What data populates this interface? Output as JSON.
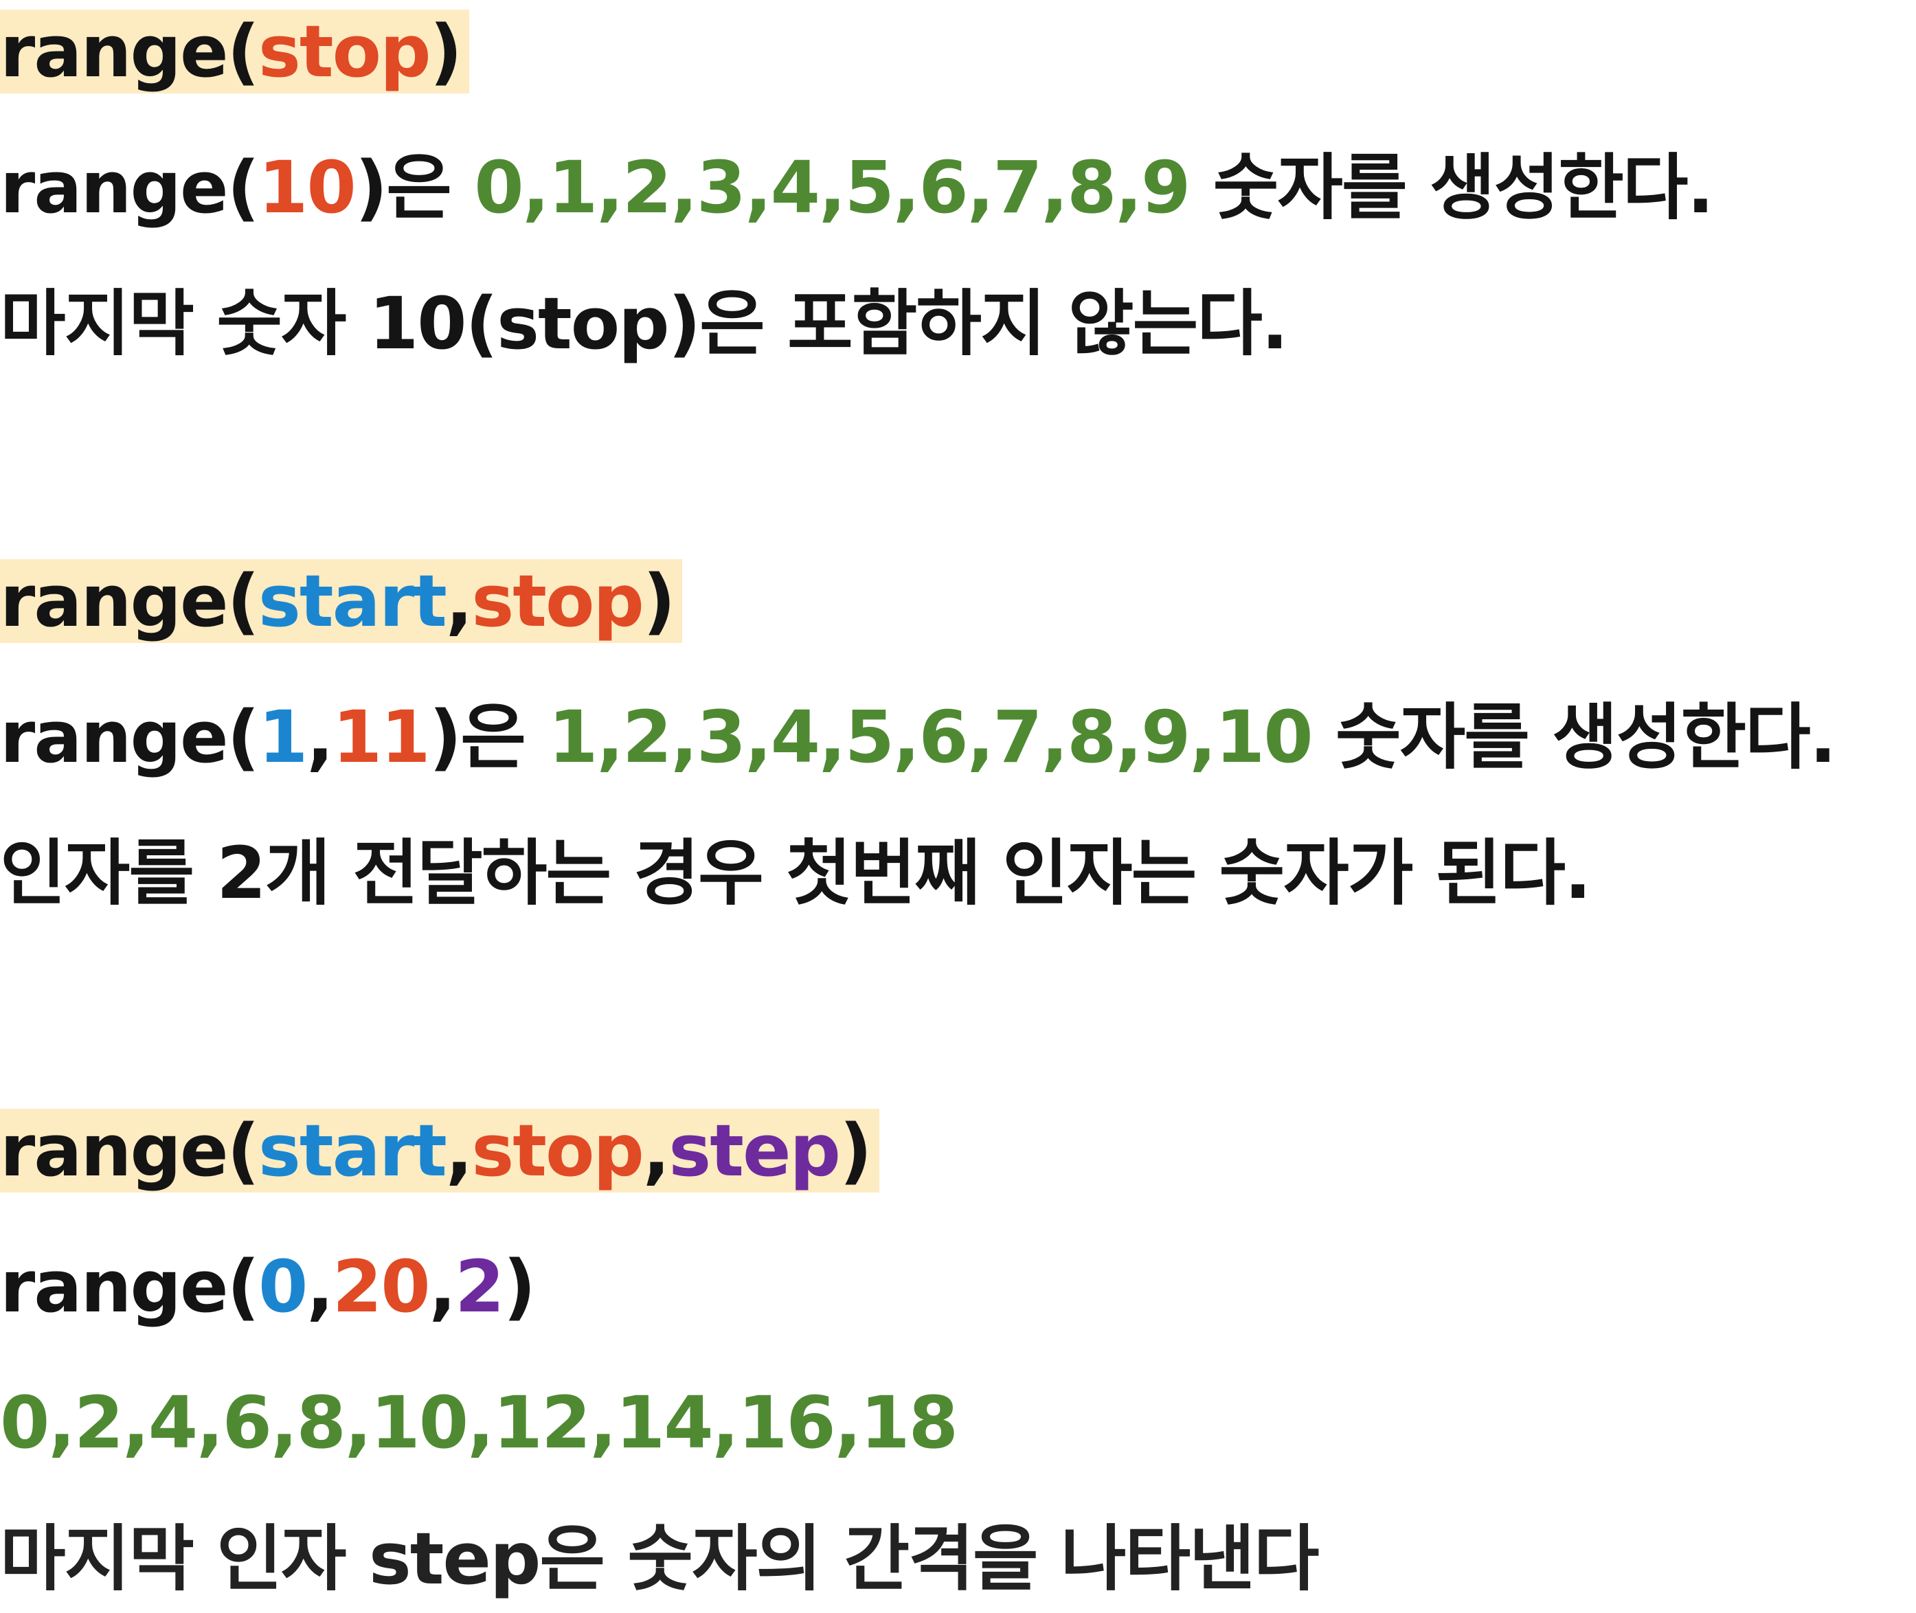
{
  "colors": {
    "highlight": "#fdebc2",
    "text": "#141414",
    "stop": "#e04a25",
    "start": "#1b86cf",
    "step": "#6d2b9e",
    "result": "#4f8a33"
  },
  "section1": {
    "signature": {
      "func": "range(",
      "stop": "stop",
      "close": ")"
    },
    "example": {
      "prefix": "range(",
      "stop": "10",
      "suffix": ")은 ",
      "result": "0,1,2,3,4,5,6,7,8,9",
      "tail": " 숫자를 생성한다."
    },
    "note": "마지막 숫자 10(stop)은 포함하지 않는다."
  },
  "section2": {
    "signature": {
      "func": "range(",
      "start": "start",
      "comma": ",",
      "stop": "stop",
      "close": ")"
    },
    "example": {
      "prefix": "range(",
      "start": "1",
      "comma": ",",
      "stop": "11",
      "suffix": ")은 ",
      "result": "1,2,3,4,5,6,7,8,9,10",
      "tail": " 숫자를 생성한다."
    },
    "note": "인자를 2개 전달하는 경우 첫번째 인자는 숫자가 된다."
  },
  "section3": {
    "signature": {
      "func": "range(",
      "start": "start",
      "comma1": ",",
      "stop": "stop",
      "comma2": ",",
      "step": "step",
      "close": ")"
    },
    "example": {
      "prefix": "range(",
      "start": "0",
      "comma1": ",",
      "stop": "20",
      "comma2": ",",
      "step": "2",
      "close": ")"
    },
    "result": "0,2,4,6,8,10,12,14,16,18",
    "note": "마지막 인자 step은 숫자의 간격을 나타낸다"
  }
}
